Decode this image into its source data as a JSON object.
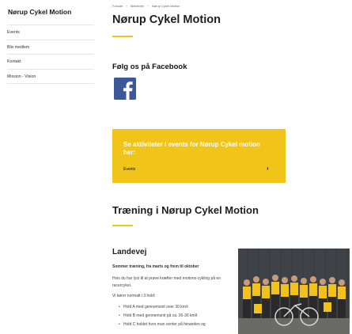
{
  "sidebar": {
    "title": "Nørup Cykel Motion",
    "items": [
      {
        "label": "Events"
      },
      {
        "label": "Bliv medlem"
      },
      {
        "label": "Kontakt"
      },
      {
        "label": "Mission - Vision"
      }
    ]
  },
  "breadcrumb": [
    "Forside",
    "›",
    "Aktiviteter",
    "›",
    "Nørup Cykel Motion"
  ],
  "page": {
    "title": "Nørup Cykel Motion",
    "facebook_heading": "Følg os på Facebook",
    "facebook_icon": "facebook-icon",
    "cta": {
      "title": "Se aktiviteter / events for Nørup Cykel motion her:",
      "link_label": "Events",
      "arrow": "›"
    },
    "section_title": "Træning i Nørup Cykel Motion",
    "subsection_title": "Landevej",
    "schedule": "Sommer træning, fra marts og frem til oktober",
    "intro": "Hvis du har lyst til at prøve kræfter med motions-cykling på en racercykel.",
    "teams_intro": "Vi kører normalt i 3 hold:",
    "teams": [
      "Hold A med gennemsnit over 30 km/t",
      "Hold B med gennemsnit på ca. 26-30 km/t",
      "Hold C holdet hvor man venter på hinanden og"
    ]
  },
  "colors": {
    "accent": "#f0c419",
    "facebook": "#3b5998",
    "jersey": "#f2c21a"
  }
}
